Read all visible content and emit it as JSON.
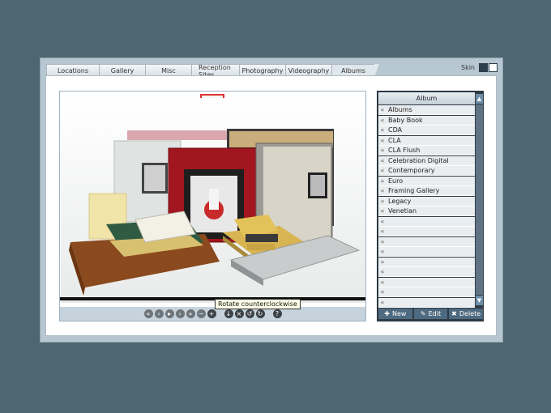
{
  "tabs": [
    {
      "label": "Locations"
    },
    {
      "label": "Gallery"
    },
    {
      "label": "Misc"
    },
    {
      "label": "Reception Sites"
    },
    {
      "label": "Photography"
    },
    {
      "label": "Videography"
    },
    {
      "label": "Albums",
      "active": true
    }
  ],
  "skin": {
    "label": "Skin",
    "swatches": [
      "#2c3e4a",
      "#ffffff"
    ]
  },
  "viewer": {
    "tooltip": "Rotate counterclockwise"
  },
  "album_panel": {
    "header": "Album",
    "items": [
      "Albums",
      "Baby Book",
      "CDA",
      "CLA",
      "CLA Flush",
      "Celebration Digital",
      "Contemporary",
      "Euro",
      "Framing Gallery",
      "Legacy",
      "Venetian"
    ],
    "empty_rows": 9,
    "buttons": {
      "new": "New",
      "edit": "Edit",
      "delete": "Delete"
    }
  },
  "colors": {
    "background": "#4e6572",
    "accent": "#4e6a80"
  }
}
